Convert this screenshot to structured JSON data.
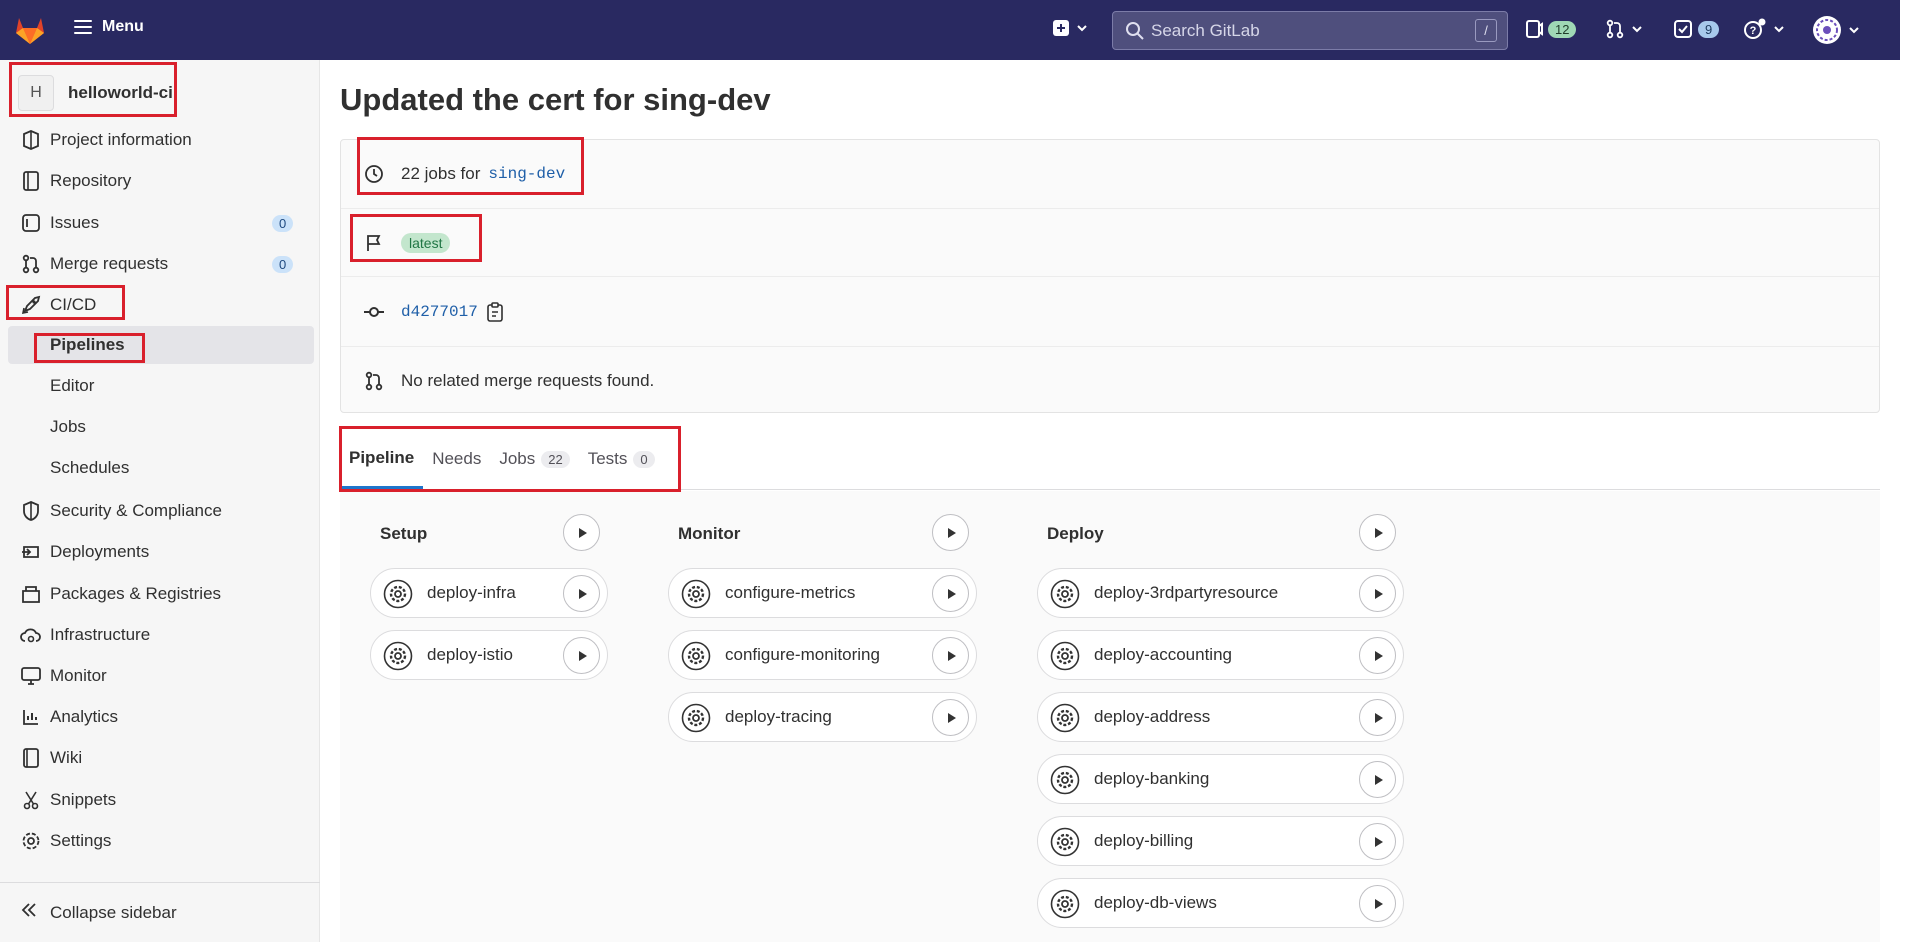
{
  "topbar": {
    "menu_label": "Menu",
    "search_placeholder": "Search GitLab",
    "search_shortcut": "/",
    "issues_count": "12",
    "todos_count": "9"
  },
  "sidebar": {
    "project_avatar_letter": "H",
    "project_name": "helloworld-ci",
    "items": [
      {
        "label": "Project information",
        "icon": "info-icon"
      },
      {
        "label": "Repository",
        "icon": "document-icon"
      },
      {
        "label": "Issues",
        "icon": "issues-icon",
        "count": "0"
      },
      {
        "label": "Merge requests",
        "icon": "merge-request-icon",
        "count": "0"
      },
      {
        "label": "CI/CD",
        "icon": "rocket-icon"
      },
      {
        "label": "Security & Compliance",
        "icon": "shield-icon"
      },
      {
        "label": "Deployments",
        "icon": "deployments-icon"
      },
      {
        "label": "Packages & Registries",
        "icon": "package-icon"
      },
      {
        "label": "Infrastructure",
        "icon": "cloud-gear-icon"
      },
      {
        "label": "Monitor",
        "icon": "monitor-icon"
      },
      {
        "label": "Analytics",
        "icon": "chart-icon"
      },
      {
        "label": "Wiki",
        "icon": "book-icon"
      },
      {
        "label": "Snippets",
        "icon": "snippet-icon"
      },
      {
        "label": "Settings",
        "icon": "gear-icon"
      }
    ],
    "cicd_sub": [
      "Pipelines",
      "Editor",
      "Jobs",
      "Schedules"
    ],
    "collapse_label": "Collapse sidebar"
  },
  "main": {
    "title": "Updated the cert for sing-dev",
    "jobs_text": "22 jobs for",
    "branch": "sing-dev",
    "latest_badge": "latest",
    "commit_sha": "d4277017",
    "merge_text": "No related merge requests found.",
    "tabs": [
      {
        "label": "Pipeline"
      },
      {
        "label": "Needs"
      },
      {
        "label": "Jobs",
        "count": "22"
      },
      {
        "label": "Tests",
        "count": "0"
      }
    ],
    "stages": [
      {
        "name": "Setup",
        "jobs": [
          "deploy-infra",
          "deploy-istio"
        ]
      },
      {
        "name": "Monitor",
        "jobs": [
          "configure-metrics",
          "configure-monitoring",
          "deploy-tracing"
        ]
      },
      {
        "name": "Deploy",
        "jobs": [
          "deploy-3rdpartyresource",
          "deploy-accounting",
          "deploy-address",
          "deploy-banking",
          "deploy-billing",
          "deploy-db-views"
        ]
      }
    ]
  },
  "colors": {
    "topbar": "#292961",
    "highlight": "#d9202c",
    "link": "#1f5fa8"
  }
}
